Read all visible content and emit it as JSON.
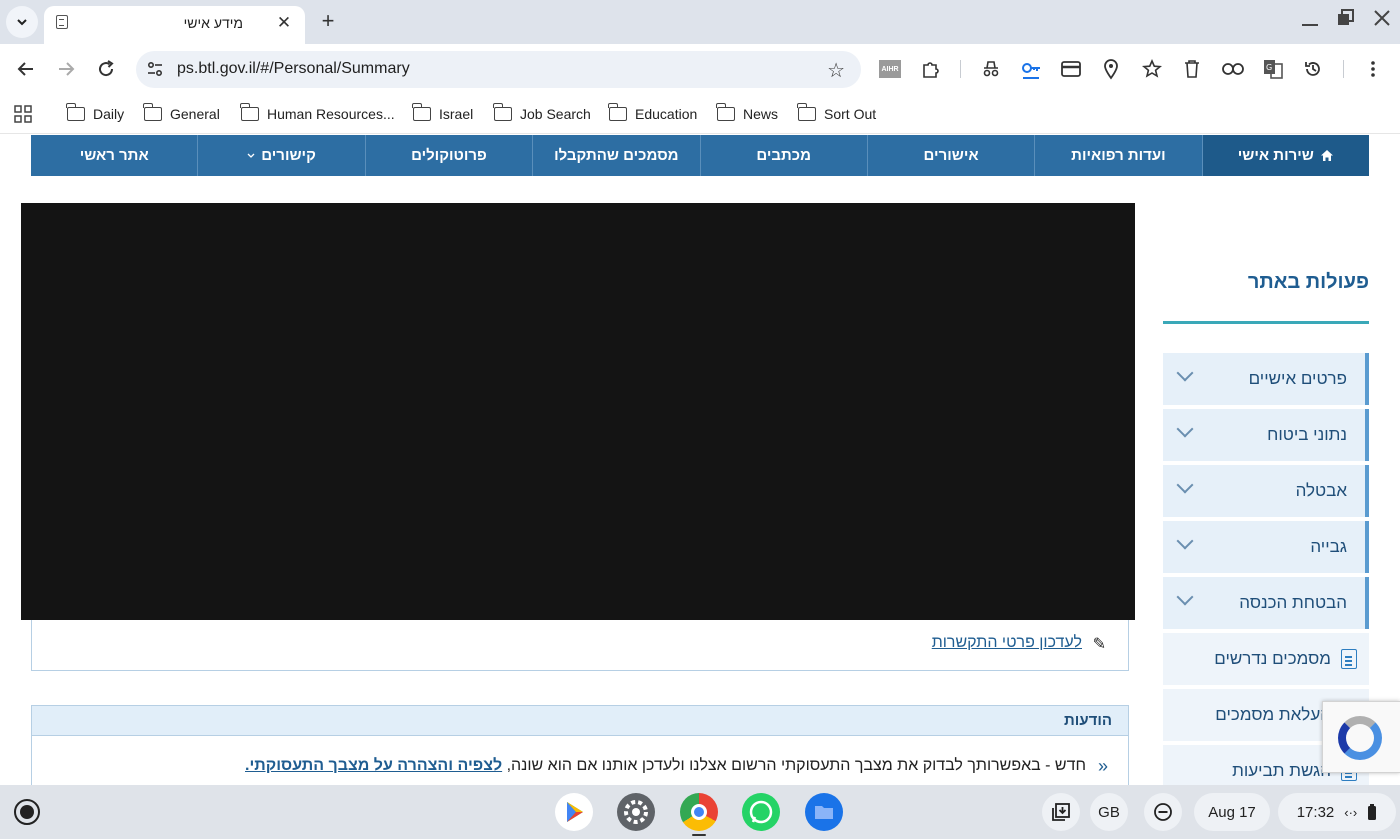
{
  "browser": {
    "tab_title": "מידע אישי",
    "url": "ps.btl.gov.il/#/Personal/Summary",
    "bookmarks": [
      "Daily",
      "General",
      "Human Resources...",
      "Israel",
      "Job Search",
      "Education",
      "News",
      "Sort Out"
    ],
    "ext_aihr_label": "AIHR"
  },
  "nav": {
    "items": [
      "שירות אישי",
      "ועדות רפואיות",
      "אישורים",
      "מכתבים",
      "מסמכים שהתקבלו",
      "פרוטוקולים",
      "קישורים",
      "אתר ראשי"
    ]
  },
  "contact": {
    "link": "לעדכון פרטי התקשרות"
  },
  "notices": {
    "title": "הודעות",
    "text": "חדש - באפשרותך לבדוק את מצבך התעסוקתי הרשום אצלנו ולעדכן אותנו אם הוא שונה,",
    "link": "לצפיה והצהרה על מצבך התעסוקתי."
  },
  "sidebar": {
    "title": "פעולות באתר",
    "items": [
      "פרטים אישיים",
      "נתוני ביטוח",
      "אבטלה",
      "גבייה",
      "הבטחת הכנסה"
    ],
    "plain_items": [
      "מסמכים נדרשים",
      "העלאת מסמכים",
      "הגשת תביעות"
    ]
  },
  "shelf": {
    "input_lang": "GB",
    "date": "Aug 17",
    "time": "17:32"
  },
  "colors": {
    "nav_bg": "#2d6ea3",
    "nav_home": "#1e5a8a",
    "accent": "#3aa8b8",
    "link": "#1f5d91"
  }
}
